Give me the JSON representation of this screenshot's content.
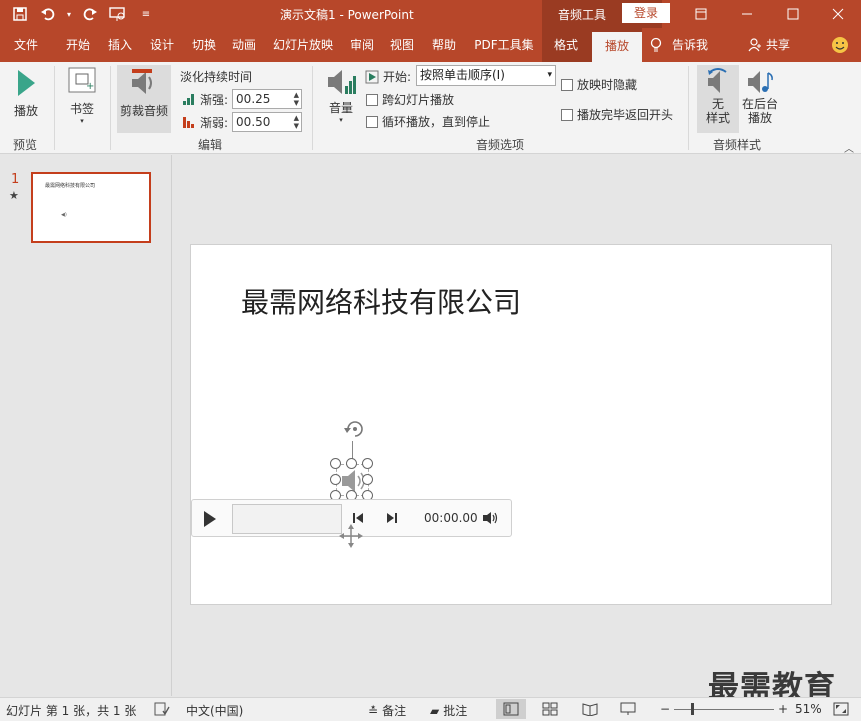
{
  "titlebar": {
    "doc_title": "演示文稿1  -  PowerPoint",
    "context_tools": "音频工具",
    "login": "登录"
  },
  "tabs": [
    {
      "label": "文件"
    },
    {
      "label": "开始"
    },
    {
      "label": "插入"
    },
    {
      "label": "设计"
    },
    {
      "label": "切换"
    },
    {
      "label": "动画"
    },
    {
      "label": "幻灯片放映"
    },
    {
      "label": "审阅"
    },
    {
      "label": "视图"
    },
    {
      "label": "帮助"
    },
    {
      "label": "PDF工具集"
    },
    {
      "label": "格式"
    },
    {
      "label": "播放"
    }
  ],
  "tell_me": "告诉我",
  "share": "共享",
  "ribbon": {
    "preview": {
      "play": "播放",
      "group": "预览"
    },
    "bookmark": {
      "label": "书签"
    },
    "edit": {
      "trim": "剪裁音频",
      "fade_title": "淡化持续时间",
      "fade_in_label": "渐强:",
      "fade_in_value": "00.25",
      "fade_out_label": "渐弱:",
      "fade_out_value": "00.50",
      "group": "编辑"
    },
    "audio_options": {
      "volume": "音量",
      "start_label": "开始:",
      "start_value": "按照单击顺序(I)",
      "cross_slides": "跨幻灯片播放",
      "loop": "循环播放，直到停止",
      "hide": "放映时隐藏",
      "rewind": "播放完毕返回开头",
      "group": "音频选项"
    },
    "audio_styles": {
      "no_style": "无\n样式",
      "no_style_1": "无",
      "no_style_2": "样式",
      "background_1": "在后台",
      "background_2": "播放",
      "group": "音频样式"
    }
  },
  "slides": {
    "number": "1",
    "thumb_title": "最需网络科技有限公司"
  },
  "slide": {
    "title": "最需网络科技有限公司"
  },
  "player": {
    "time": "00:00.00"
  },
  "status": {
    "slide_info": "幻灯片 第 1 张，共 1 张",
    "language": "中文(中国)",
    "notes": "备注",
    "comments": "批注",
    "zoom": "51%"
  },
  "watermark": "最需教育",
  "colors": {
    "accent": "#b7472a",
    "context": "#9a3b22",
    "active_tab_text": "#b7472a"
  }
}
